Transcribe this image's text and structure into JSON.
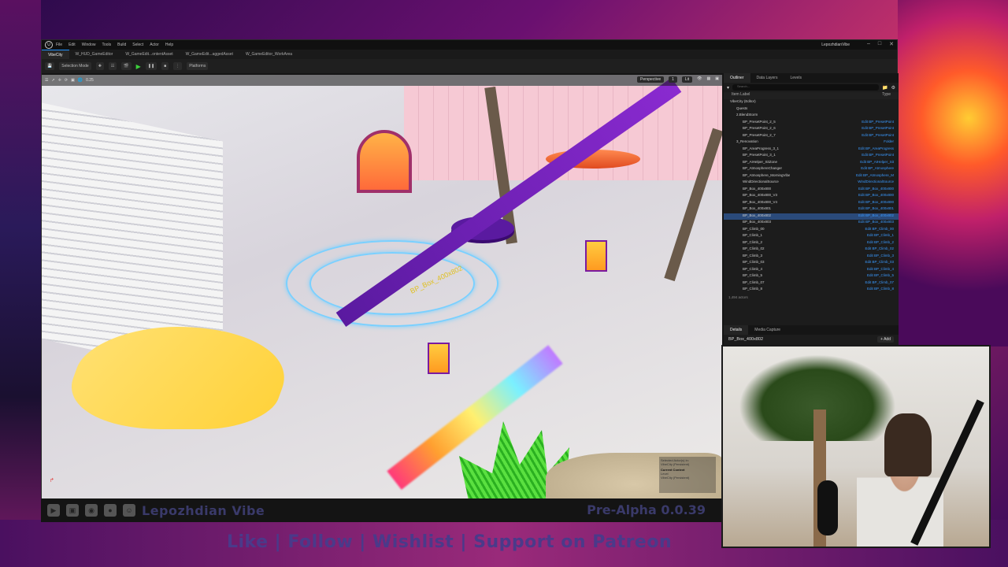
{
  "editor": {
    "logo": "U",
    "project": "VibeCity",
    "menu": [
      "File",
      "Edit",
      "Window",
      "Tools",
      "Build",
      "Select",
      "Actor",
      "Help"
    ],
    "window_title": "LepozhdianVibe",
    "tabs": [
      "VibeCity",
      "W_HUD_GameEditor",
      "W_GameEdit...ontentAsset",
      "W_GameEdit...aggedAsset",
      "W_GameEditor_WorkArea"
    ],
    "toolbar": {
      "mode": "Selection Mode",
      "platforms": "Platforms"
    }
  },
  "viewport": {
    "view_mode": "Perspective",
    "lit": "Lit",
    "snap_value": "0.25",
    "camera_speed": "1",
    "context": {
      "selected_label": "Selected Actor(s) in:",
      "selected_value": "VibeCity (Persistent)",
      "title": "Current Context",
      "level_label": "Level",
      "level_value": "VibeCity (Persistent)"
    }
  },
  "outliner": {
    "tabs": [
      "Outliner",
      "Data Layers",
      "Levels"
    ],
    "search_placeholder": "Search...",
    "col_label": "Item Label",
    "col_type": "Type",
    "rows": [
      {
        "name": "VibeCity (Editor)",
        "type": ""
      },
      {
        "name": "Quests",
        "type": ""
      },
      {
        "name": "2.BlendStorm",
        "type": ""
      },
      {
        "name": "BP_PresetPoint_2_5",
        "type": "Edit BP_PresetPoint"
      },
      {
        "name": "BP_PresetPoint_2_6",
        "type": "Edit BP_PresetPoint"
      },
      {
        "name": "BP_PresetPoint_2_7",
        "type": "Edit BP_PresetPoint"
      },
      {
        "name": "3_Renovation",
        "type": "Folder"
      },
      {
        "name": "BP_AreaProgress_3_1",
        "type": "Edit BP_AreaProgress"
      },
      {
        "name": "BP_PresetPoint_3_1",
        "type": "Edit BP_PresetPoint"
      },
      {
        "name": "BP_AIHelper_SitZone",
        "type": "Edit BP_AIHelper_Sit"
      },
      {
        "name": "BP_AtmosphereChanger",
        "type": "Edit BP_Atmosphere"
      },
      {
        "name": "BP_Atmosphere_MorningVibe",
        "type": "Edit BP_Atmosphere_M"
      },
      {
        "name": "WindDirectionalSource",
        "type": "WindDirectionalSource"
      },
      {
        "name": "BP_Box_400x800",
        "type": "Edit BP_Box_400x800"
      },
      {
        "name": "BP_Box_400x800_V3",
        "type": "Edit BP_Box_400x800"
      },
      {
        "name": "BP_Box_400x800_V4",
        "type": "Edit BP_Box_400x800"
      },
      {
        "name": "BP_Box_400x801",
        "type": "Edit BP_Box_400x801"
      },
      {
        "name": "BP_Box_400x802",
        "type": "Edit BP_Box_400x802"
      },
      {
        "name": "BP_Box_400x803",
        "type": "Edit BP_Box_400x803"
      },
      {
        "name": "BP_Climb_00",
        "type": "Edit BP_Climb_00"
      },
      {
        "name": "BP_Climb_1",
        "type": "Edit BP_Climb_1"
      },
      {
        "name": "BP_Climb_2",
        "type": "Edit BP_Climb_2"
      },
      {
        "name": "BP_Climb_02",
        "type": "Edit BP_Climb_02"
      },
      {
        "name": "BP_Climb_3",
        "type": "Edit BP_Climb_3"
      },
      {
        "name": "BP_Climb_03",
        "type": "Edit BP_Climb_03"
      },
      {
        "name": "BP_Climb_4",
        "type": "Edit BP_Climb_4"
      },
      {
        "name": "BP_Climb_5",
        "type": "Edit BP_Climb_5"
      },
      {
        "name": "BP_Climb_07",
        "type": "Edit BP_Climb_07"
      },
      {
        "name": "BP_Climb_8",
        "type": "Edit BP_Climb_8"
      }
    ],
    "selected_index": 17,
    "actor_count": "1,494 actors"
  },
  "details": {
    "tabs": [
      "Details",
      "Media Capture"
    ],
    "actor_name": "BP_Box_400x802",
    "add_label": "+ Add"
  },
  "overlay": {
    "channel_name": "Lepozhdian Vibe",
    "version": "Pre-Alpha 0.0.39",
    "cta": "Like | Follow | Wishlist | Support on Patreon",
    "selected_actor_label": "BP_Box_400x802"
  },
  "colors": {
    "accent": "#1e90ff",
    "play": "#3cd03c",
    "overlay_text": "#3a3a6a"
  }
}
